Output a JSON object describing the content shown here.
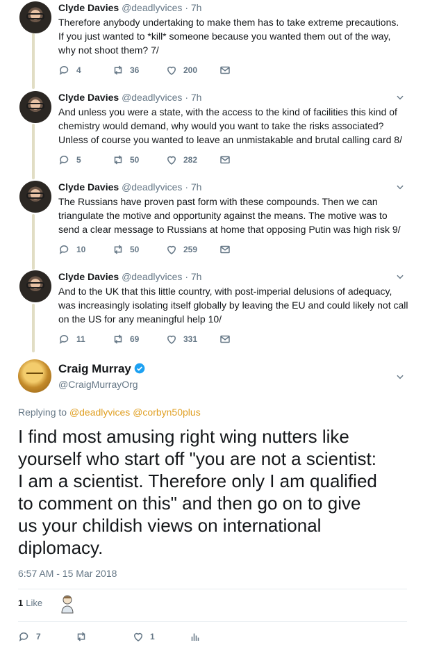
{
  "thread": [
    {
      "name": "Clyde Davies",
      "handle": "@deadlyvices · 7h",
      "text_lines": [
        "Therefore anybody undertaking to make them has to take extreme precautions.",
        "If you just wanted to *kill* someone because you wanted them out of the way,",
        "why not shoot them? 7/"
      ],
      "replies": "4",
      "retweets": "36",
      "likes": "200"
    },
    {
      "name": "Clyde Davies",
      "handle": "@deadlyvices · 7h",
      "text_lines": [
        "And unless you were a state, with the access to the kind of facilities this kind of",
        "chemistry would demand, why would you want to take the risks associated?",
        "Unless of course you wanted to leave an unmistakable and brutal calling card 8/"
      ],
      "replies": "5",
      "retweets": "50",
      "likes": "282"
    },
    {
      "name": "Clyde Davies",
      "handle": "@deadlyvices · 7h",
      "text_lines": [
        "The Russians have proven past form with these compounds.  Then we can",
        "triangulate the motive and opportunity against the means.  The motive was to",
        "send a clear message to Russians at home that opposing Putin was high risk 9/"
      ],
      "replies": "10",
      "retweets": "50",
      "likes": "259"
    },
    {
      "name": "Clyde Davies",
      "handle": "@deadlyvices · 7h",
      "text_lines": [
        "And to the UK that this little country, with post-imperial delusions of adequacy,",
        "was increasingly isolating itself globally by leaving the EU and could likely not call",
        "on the US for any meaningful help 10/"
      ],
      "replies": "11",
      "retweets": "69",
      "likes": "331"
    }
  ],
  "main_tweet": {
    "name": "Craig Murray",
    "handle": "@CraigMurrayOrg",
    "replying_prefix": "Replying to",
    "mention_1": "@deadlyvices",
    "mention_2": "@corbyn50plus",
    "text_lines": [
      "I find most amusing right wing nutters like",
      "yourself who start off \"you are not a scientist:",
      "I am a scientist. Therefore only I am qualified",
      "to comment on this\" and then go on to give",
      "us your childish views on international",
      "diplomacy."
    ],
    "timestamp": "6:57 AM - 15 Mar 2018",
    "like_count": "1",
    "like_label": "Like",
    "replies": "7",
    "retweets": "",
    "likes": "1"
  },
  "colors": {
    "accent_mention": "#e0a024",
    "verified": "#1da1f2",
    "thread_line": "#e1ddc4",
    "muted": "#657786"
  }
}
